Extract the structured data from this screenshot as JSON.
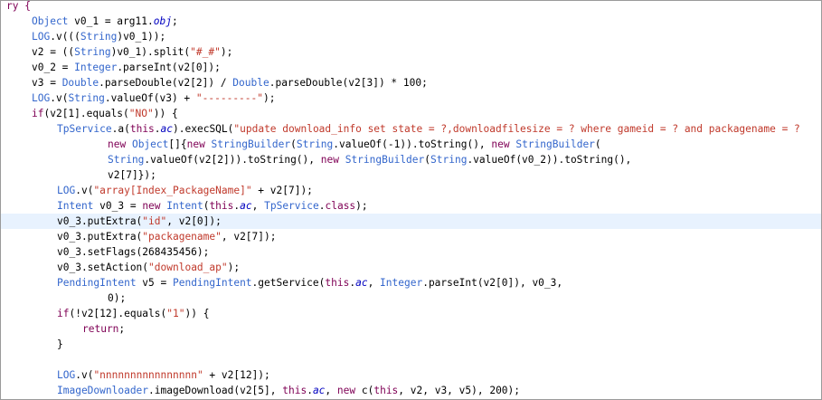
{
  "editor": {
    "highlighted_line": 14,
    "lines": [
      {
        "indent": 0,
        "tokens": [
          {
            "t": "ry {",
            "c": "k"
          }
        ]
      },
      {
        "indent": 1,
        "tokens": [
          {
            "t": "Object",
            "c": "c"
          },
          {
            "t": " v0_1 = arg11.",
            "c": "p"
          },
          {
            "t": "obj",
            "c": "i"
          },
          {
            "t": ";",
            "c": "p"
          }
        ]
      },
      {
        "indent": 1,
        "tokens": [
          {
            "t": "LOG",
            "c": "c"
          },
          {
            "t": ".v(((",
            "c": "p"
          },
          {
            "t": "String",
            "c": "c"
          },
          {
            "t": ")v0_1));",
            "c": "p"
          }
        ]
      },
      {
        "indent": 1,
        "tokens": [
          {
            "t": "v2 = ((",
            "c": "p"
          },
          {
            "t": "String",
            "c": "c"
          },
          {
            "t": ")v0_1).split(",
            "c": "p"
          },
          {
            "t": "\"#_#\"",
            "c": "s"
          },
          {
            "t": ");",
            "c": "p"
          }
        ]
      },
      {
        "indent": 1,
        "tokens": [
          {
            "t": "v0_2 = ",
            "c": "p"
          },
          {
            "t": "Integer",
            "c": "c"
          },
          {
            "t": ".parseInt(v2[0]);",
            "c": "p"
          }
        ]
      },
      {
        "indent": 1,
        "tokens": [
          {
            "t": "v3 = ",
            "c": "p"
          },
          {
            "t": "Double",
            "c": "c"
          },
          {
            "t": ".parseDouble(v2[2]) / ",
            "c": "p"
          },
          {
            "t": "Double",
            "c": "c"
          },
          {
            "t": ".parseDouble(v2[3]) * 100;",
            "c": "p"
          }
        ]
      },
      {
        "indent": 1,
        "tokens": [
          {
            "t": "LOG",
            "c": "c"
          },
          {
            "t": ".v(",
            "c": "p"
          },
          {
            "t": "String",
            "c": "c"
          },
          {
            "t": ".valueOf(v3) + ",
            "c": "p"
          },
          {
            "t": "\"---------\"",
            "c": "s"
          },
          {
            "t": ");",
            "c": "p"
          }
        ]
      },
      {
        "indent": 1,
        "tokens": [
          {
            "t": "if",
            "c": "k"
          },
          {
            "t": "(v2[1].equals(",
            "c": "p"
          },
          {
            "t": "\"NO\"",
            "c": "s"
          },
          {
            "t": ")) {",
            "c": "p"
          }
        ]
      },
      {
        "indent": 2,
        "tokens": [
          {
            "t": "TpService",
            "c": "c"
          },
          {
            "t": ".a(",
            "c": "p"
          },
          {
            "t": "this",
            "c": "k"
          },
          {
            "t": ".",
            "c": "p"
          },
          {
            "t": "ac",
            "c": "i"
          },
          {
            "t": ").execSQL(",
            "c": "p"
          },
          {
            "t": "\"update download_info set state = ?,downloadfilesize = ? where gameid = ? and packagename = ?",
            "c": "s"
          }
        ]
      },
      {
        "indent": 4,
        "tokens": [
          {
            "t": "new ",
            "c": "k"
          },
          {
            "t": "Object",
            "c": "c"
          },
          {
            "t": "[]{",
            "c": "p"
          },
          {
            "t": "new ",
            "c": "k"
          },
          {
            "t": "StringBuilder",
            "c": "c"
          },
          {
            "t": "(",
            "c": "p"
          },
          {
            "t": "String",
            "c": "c"
          },
          {
            "t": ".valueOf(-1)).toString(), ",
            "c": "p"
          },
          {
            "t": "new ",
            "c": "k"
          },
          {
            "t": "StringBuilder",
            "c": "c"
          },
          {
            "t": "(",
            "c": "p"
          }
        ]
      },
      {
        "indent": 4,
        "tokens": [
          {
            "t": "String",
            "c": "c"
          },
          {
            "t": ".valueOf(v2[2])).toString(), ",
            "c": "p"
          },
          {
            "t": "new ",
            "c": "k"
          },
          {
            "t": "StringBuilder",
            "c": "c"
          },
          {
            "t": "(",
            "c": "p"
          },
          {
            "t": "String",
            "c": "c"
          },
          {
            "t": ".valueOf(v0_2)).toString(),",
            "c": "p"
          }
        ]
      },
      {
        "indent": 4,
        "tokens": [
          {
            "t": "v2[7]});",
            "c": "p"
          }
        ]
      },
      {
        "indent": 2,
        "tokens": [
          {
            "t": "LOG",
            "c": "c"
          },
          {
            "t": ".v(",
            "c": "p"
          },
          {
            "t": "\"array[Index_PackageName]\"",
            "c": "s"
          },
          {
            "t": " + v2[7]);",
            "c": "p"
          }
        ]
      },
      {
        "indent": 2,
        "tokens": [
          {
            "t": "Intent",
            "c": "c"
          },
          {
            "t": " v0_3 = ",
            "c": "p"
          },
          {
            "t": "new ",
            "c": "k"
          },
          {
            "t": "Intent",
            "c": "c"
          },
          {
            "t": "(",
            "c": "p"
          },
          {
            "t": "this",
            "c": "k"
          },
          {
            "t": ".",
            "c": "p"
          },
          {
            "t": "ac",
            "c": "i"
          },
          {
            "t": ", ",
            "c": "p"
          },
          {
            "t": "TpService",
            "c": "c"
          },
          {
            "t": ".",
            "c": "p"
          },
          {
            "t": "class",
            "c": "k"
          },
          {
            "t": ");",
            "c": "p"
          }
        ]
      },
      {
        "indent": 2,
        "tokens": [
          {
            "t": "v0_3.putExtra(",
            "c": "p"
          },
          {
            "t": "\"id\"",
            "c": "s"
          },
          {
            "t": ", v2[0]);",
            "c": "p"
          }
        ]
      },
      {
        "indent": 2,
        "tokens": [
          {
            "t": "v0_3.putExtra(",
            "c": "p"
          },
          {
            "t": "\"packagename\"",
            "c": "s"
          },
          {
            "t": ", v2[7]);",
            "c": "p"
          }
        ]
      },
      {
        "indent": 2,
        "tokens": [
          {
            "t": "v0_3.setFlags(268435456);",
            "c": "p"
          }
        ]
      },
      {
        "indent": 2,
        "tokens": [
          {
            "t": "v0_3.setAction(",
            "c": "p"
          },
          {
            "t": "\"download_ap\"",
            "c": "s"
          },
          {
            "t": ");",
            "c": "p"
          }
        ]
      },
      {
        "indent": 2,
        "tokens": [
          {
            "t": "PendingIntent",
            "c": "c"
          },
          {
            "t": " v5 = ",
            "c": "p"
          },
          {
            "t": "PendingIntent",
            "c": "c"
          },
          {
            "t": ".getService(",
            "c": "p"
          },
          {
            "t": "this",
            "c": "k"
          },
          {
            "t": ".",
            "c": "p"
          },
          {
            "t": "ac",
            "c": "i"
          },
          {
            "t": ", ",
            "c": "p"
          },
          {
            "t": "Integer",
            "c": "c"
          },
          {
            "t": ".parseInt(v2[0]), v0_3,",
            "c": "p"
          }
        ]
      },
      {
        "indent": 4,
        "tokens": [
          {
            "t": "0);",
            "c": "p"
          }
        ]
      },
      {
        "indent": 2,
        "tokens": [
          {
            "t": "if",
            "c": "k"
          },
          {
            "t": "(!v2[12].equals(",
            "c": "p"
          },
          {
            "t": "\"1\"",
            "c": "s"
          },
          {
            "t": ")) {",
            "c": "p"
          }
        ]
      },
      {
        "indent": 3,
        "tokens": [
          {
            "t": "return",
            "c": "k"
          },
          {
            "t": ";",
            "c": "p"
          }
        ]
      },
      {
        "indent": 2,
        "tokens": [
          {
            "t": "}",
            "c": "p"
          }
        ]
      },
      {
        "indent": 0,
        "tokens": []
      },
      {
        "indent": 2,
        "tokens": [
          {
            "t": "LOG",
            "c": "c"
          },
          {
            "t": ".v(",
            "c": "p"
          },
          {
            "t": "\"nnnnnnnnnnnnnnnn\"",
            "c": "s"
          },
          {
            "t": " + v2[12]);",
            "c": "p"
          }
        ]
      },
      {
        "indent": 2,
        "tokens": [
          {
            "t": "ImageDownloader",
            "c": "c"
          },
          {
            "t": ".imageDownload(v2[5], ",
            "c": "p"
          },
          {
            "t": "this",
            "c": "k"
          },
          {
            "t": ".",
            "c": "p"
          },
          {
            "t": "ac",
            "c": "i"
          },
          {
            "t": ", ",
            "c": "p"
          },
          {
            "t": "new ",
            "c": "k"
          },
          {
            "t": "c(",
            "c": "p"
          },
          {
            "t": "this",
            "c": "k"
          },
          {
            "t": ", v2, v3, v5), 200);",
            "c": "p"
          }
        ]
      }
    ]
  }
}
